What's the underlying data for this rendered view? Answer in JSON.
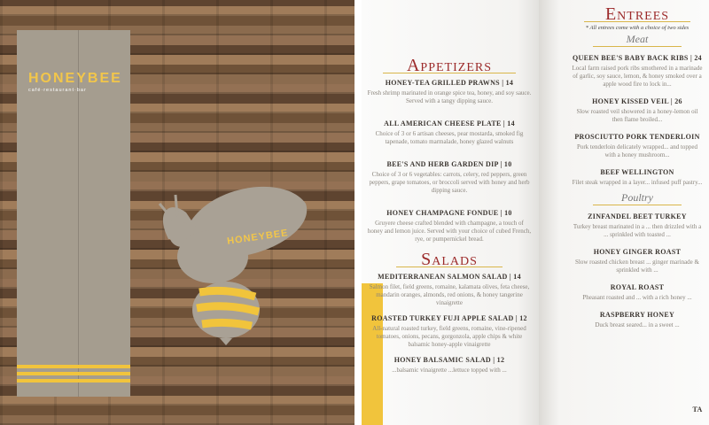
{
  "cover": {
    "logo_name": "HONEYBEE",
    "logo_tagline": "café·restaurant·bar",
    "bee_logo": "HONEYBEE"
  },
  "menu": {
    "appetizers_title": "Appetizers",
    "appetizers": [
      {
        "name": "HONEY-TEA GRILLED PRAWNS | 14",
        "desc": "Fresh shrimp marinated in orange spice tea, honey, and soy sauce. Served with a tangy dipping sauce."
      },
      {
        "name": "ALL AMERICAN CHEESE PLATE | 14",
        "desc": "Choice of 3 or 6 artisan cheeses, pear mostarda, smoked fig tapenade, tomato marmalade, honey glazed walnuts"
      },
      {
        "name": "BEE'S AND HERB GARDEN DIP | 10",
        "desc": "Choice of 3 or 6 vegetables: carrots, celery, red peppers, green peppers, grape tomatoes, or broccoli served with honey and herb dipping sauce."
      },
      {
        "name": "HONEY CHAMPAGNE FONDUE | 10",
        "desc": "Gruyere cheese crafted blended with champagne, a touch of honey and lemon juice. Served with your choice of cubed French, rye, or pumpernickel bread."
      }
    ],
    "salads_title": "Salads",
    "salads": [
      {
        "name": "MEDITERRANEAN SALMON SALAD | 14",
        "desc": "Salmon filet, field greens, romaine, kalamata olives, feta cheese, mandarin oranges, almonds, red onions, & honey tangerine vinaigrette"
      },
      {
        "name": "ROASTED TURKEY FUJI APPLE SALAD | 12",
        "desc": "All-natural roasted turkey, field greens, romaine, vine-ripened tomatoes, onions, pecans, gorgonzola, apple chips & white balsamic honey-apple vinaigrette"
      },
      {
        "name": "HONEY BALSAMIC SALAD | 12",
        "desc": "...balsamic vinaigrette ...lettuce topped with ..."
      }
    ],
    "entrees_title": "Entrees",
    "entrees_note": "* All entrees come with a choice of two sides",
    "meat_title": "Meat",
    "meat": [
      {
        "name": "QUEEN BEE'S BABY BACK RIBS | 24",
        "desc": "Local farm raised pork ribs smothered in a marinade of garlic, soy sauce, lemon, & honey smoked over a apple wood fire to lock in..."
      },
      {
        "name": "HONEY KISSED VEIL | 26",
        "desc": "Slow roasted veil showered in a honey-lemon oil then flame broiled..."
      },
      {
        "name": "PROSCIUTTO PORK TENDERLOIN",
        "desc": "Pork tenderloin delicately wrapped... and topped with a honey mushroom..."
      },
      {
        "name": "BEEF WELLINGTON",
        "desc": "Filet steak wrapped in a layer... infused puff pastry..."
      }
    ],
    "poultry_title": "Poultry",
    "poultry": [
      {
        "name": "ZINFANDEL BEET TURKEY",
        "desc": "Turkey breast marinated in a ... then drizzled with a ... sprinkled with toasted ..."
      },
      {
        "name": "HONEY GINGER ROAST",
        "desc": "Slow roasted chicken breast ... ginger marinade & sprinkled with ..."
      },
      {
        "name": "ROYAL ROAST",
        "desc": "Pheasant roasted and ... with a rich honey ..."
      },
      {
        "name": "RASPBERRY HONEY",
        "desc": "Duck breast seared... in a sweet ..."
      }
    ],
    "bottom_cut": "TA"
  }
}
